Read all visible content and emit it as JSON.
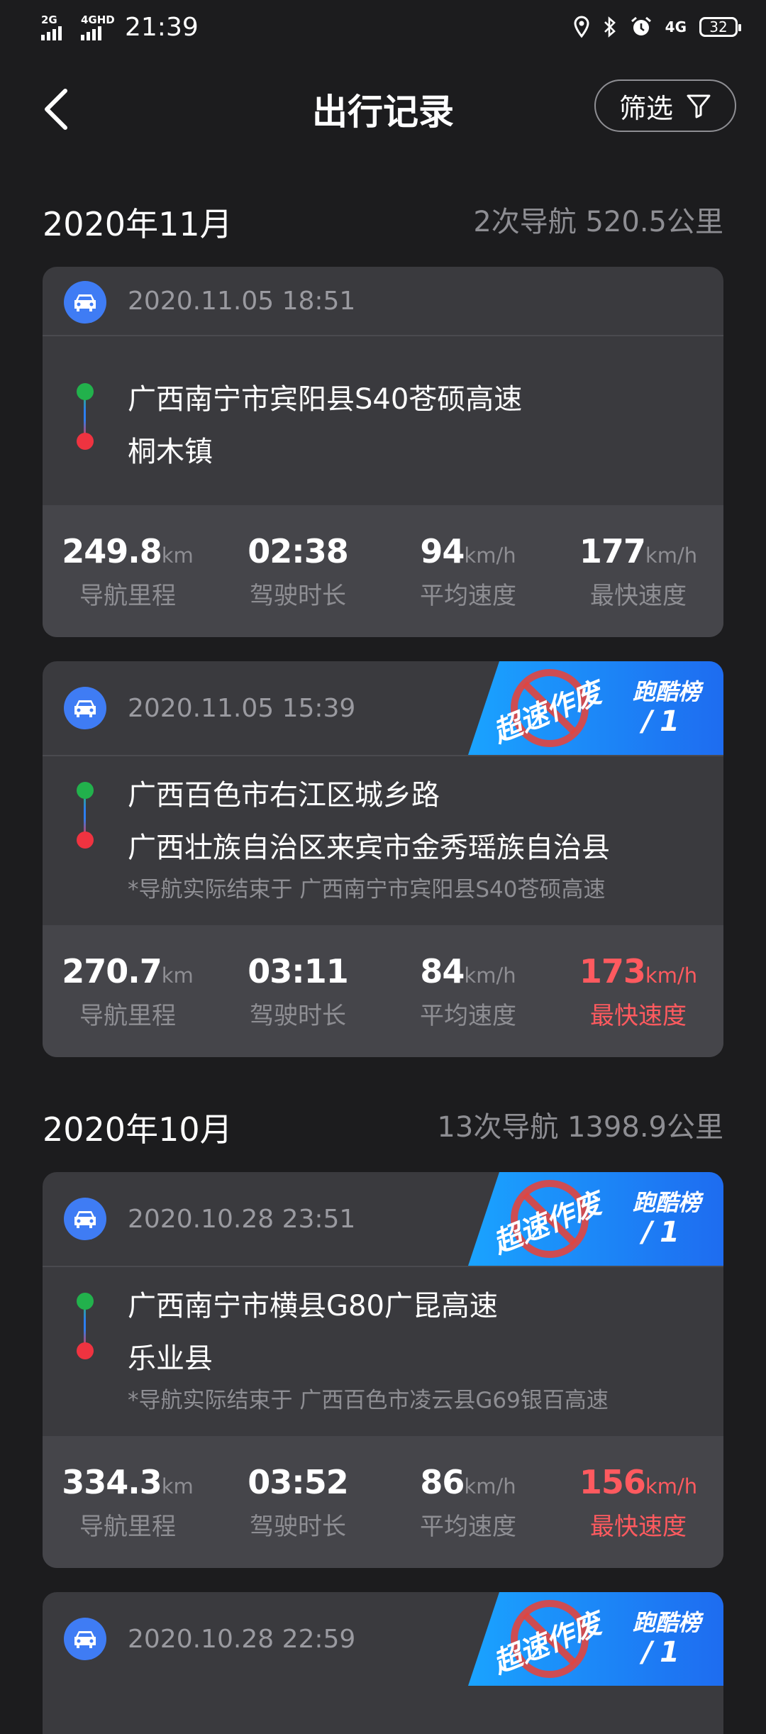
{
  "status_bar": {
    "net1": "2G",
    "net2": "4GHD",
    "time": "21:39",
    "net3": "4G",
    "battery": "32"
  },
  "header": {
    "title": "出行记录",
    "filter_label": "筛选"
  },
  "months": [
    {
      "title": "2020年11月",
      "summary": "2次导航  520.5公里",
      "cards": [
        {
          "datetime": "2020.11.05 18:51",
          "from": "广西南宁市宾阳县S40苍硕高速",
          "to": "桐木镇",
          "stats": [
            {
              "value": "249.8",
              "unit": "km",
              "label": "导航里程"
            },
            {
              "value": "02:38",
              "unit": "",
              "label": "驾驶时长"
            },
            {
              "value": "94",
              "unit": "km/h",
              "label": "平均速度"
            },
            {
              "value": "177",
              "unit": "km/h",
              "label": "最快速度"
            }
          ]
        },
        {
          "datetime": "2020.11.05 15:39",
          "badge": {
            "stamp": "超速作废",
            "board": "跑酷榜",
            "rank_sep": "/",
            "rank": "1"
          },
          "from": "广西百色市右江区城乡路",
          "to": "广西壮族自治区来宾市金秀瑶族自治县",
          "note": "*导航实际结束于 广西南宁市宾阳县S40苍硕高速",
          "stats": [
            {
              "value": "270.7",
              "unit": "km",
              "label": "导航里程"
            },
            {
              "value": "03:11",
              "unit": "",
              "label": "驾驶时长"
            },
            {
              "value": "84",
              "unit": "km/h",
              "label": "平均速度"
            },
            {
              "value": "173",
              "unit": "km/h",
              "label": "最快速度"
            }
          ]
        }
      ]
    },
    {
      "title": "2020年10月",
      "summary": "13次导航  1398.9公里",
      "cards": [
        {
          "datetime": "2020.10.28 23:51",
          "badge": {
            "stamp": "超速作废",
            "board": "跑酷榜",
            "rank_sep": "/",
            "rank": "1"
          },
          "from": "广西南宁市横县G80广昆高速",
          "to": "乐业县",
          "note": "*导航实际结束于 广西百色市凌云县G69银百高速",
          "stats": [
            {
              "value": "334.3",
              "unit": "km",
              "label": "导航里程"
            },
            {
              "value": "03:52",
              "unit": "",
              "label": "驾驶时长"
            },
            {
              "value": "86",
              "unit": "km/h",
              "label": "平均速度"
            },
            {
              "value": "156",
              "unit": "km/h",
              "label": "最快速度"
            }
          ]
        },
        {
          "datetime": "2020.10.28 22:59",
          "badge": {
            "stamp": "超速作废",
            "board": "跑酷榜",
            "rank_sep": "/",
            "rank": "1"
          }
        }
      ]
    }
  ],
  "colors": {
    "background": "#1c1c1e",
    "card": "#3a3a3e",
    "accent_blue": "#3f7cf4",
    "highlight_red": "#ff5a5f"
  }
}
